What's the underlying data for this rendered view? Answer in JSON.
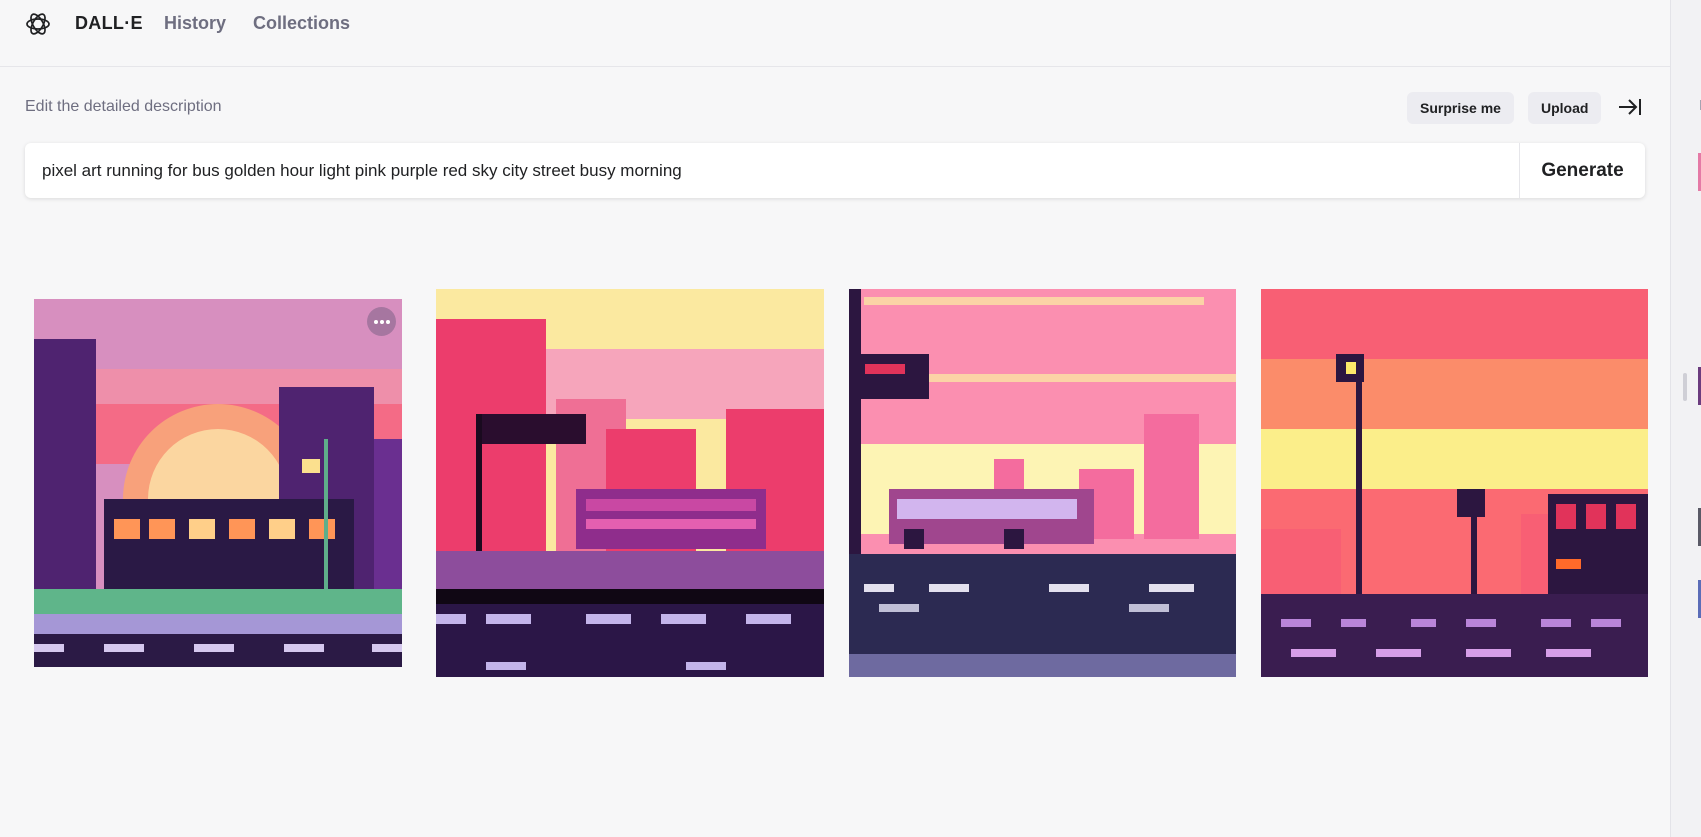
{
  "header": {
    "brand": "DALL·E",
    "nav": [
      {
        "label": "History"
      },
      {
        "label": "Collections"
      }
    ],
    "logo_icon": "openai-logo-icon"
  },
  "editor": {
    "label": "Edit the detailed description",
    "surprise_label": "Surprise me",
    "upload_label": "Upload",
    "collapse_icon": "collapse-right-icon",
    "prompt_value": "pixel art running for bus golden hour light pink purple red sky city street busy morning",
    "generate_label": "Generate"
  },
  "results": {
    "images": [
      {
        "subject": "pixel art bus at sunset with purple buildings"
      },
      {
        "subject": "pixel art bus with bus stop sign and pink skyline"
      },
      {
        "subject": "pixel art bus on purple street with bus stop"
      },
      {
        "subject": "pixel art street with lamp posts and pink sky"
      }
    ],
    "more_icon": "more-options-icon"
  },
  "sidebar": {
    "letter": "P"
  },
  "colors": {
    "background": "#f7f7f8",
    "muted_text": "#6e6e80",
    "pill_bg": "#ececf1"
  }
}
